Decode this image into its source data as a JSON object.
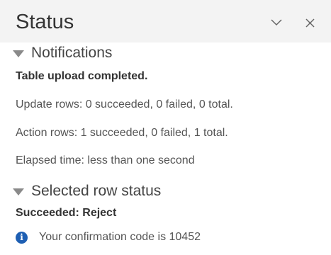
{
  "header": {
    "title": "Status",
    "minimize_icon": "chevron-down-icon",
    "close_icon": "close-icon"
  },
  "notifications": {
    "label": "Notifications",
    "heading": "Table upload completed.",
    "update_rows": "Update rows:  0 succeeded, 0 failed, 0 total.",
    "action_rows": "Action rows: 1 succeeded, 0 failed, 1 total.",
    "elapsed": "Elapsed time: less than one second"
  },
  "selected_row": {
    "label": "Selected row status",
    "heading": "Succeeded: Reject",
    "info_icon": "i",
    "message": "Your confirmation code is 10452"
  },
  "colors": {
    "header_bg": "#f3f3f3",
    "info_blue": "#1e5fb3"
  }
}
